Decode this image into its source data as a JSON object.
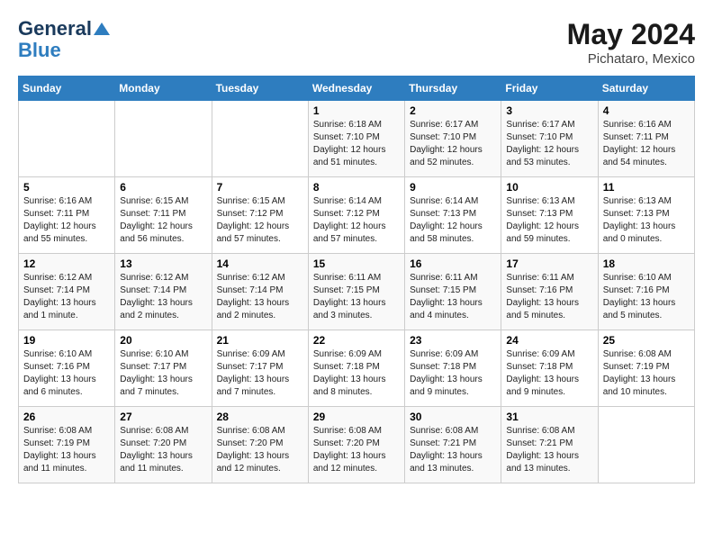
{
  "header": {
    "logo_line1": "General",
    "logo_line2": "Blue",
    "month_year": "May 2024",
    "location": "Pichataro, Mexico"
  },
  "days_of_week": [
    "Sunday",
    "Monday",
    "Tuesday",
    "Wednesday",
    "Thursday",
    "Friday",
    "Saturday"
  ],
  "weeks": [
    [
      {
        "day": "",
        "info": ""
      },
      {
        "day": "",
        "info": ""
      },
      {
        "day": "",
        "info": ""
      },
      {
        "day": "1",
        "info": "Sunrise: 6:18 AM\nSunset: 7:10 PM\nDaylight: 12 hours\nand 51 minutes."
      },
      {
        "day": "2",
        "info": "Sunrise: 6:17 AM\nSunset: 7:10 PM\nDaylight: 12 hours\nand 52 minutes."
      },
      {
        "day": "3",
        "info": "Sunrise: 6:17 AM\nSunset: 7:10 PM\nDaylight: 12 hours\nand 53 minutes."
      },
      {
        "day": "4",
        "info": "Sunrise: 6:16 AM\nSunset: 7:11 PM\nDaylight: 12 hours\nand 54 minutes."
      }
    ],
    [
      {
        "day": "5",
        "info": "Sunrise: 6:16 AM\nSunset: 7:11 PM\nDaylight: 12 hours\nand 55 minutes."
      },
      {
        "day": "6",
        "info": "Sunrise: 6:15 AM\nSunset: 7:11 PM\nDaylight: 12 hours\nand 56 minutes."
      },
      {
        "day": "7",
        "info": "Sunrise: 6:15 AM\nSunset: 7:12 PM\nDaylight: 12 hours\nand 57 minutes."
      },
      {
        "day": "8",
        "info": "Sunrise: 6:14 AM\nSunset: 7:12 PM\nDaylight: 12 hours\nand 57 minutes."
      },
      {
        "day": "9",
        "info": "Sunrise: 6:14 AM\nSunset: 7:13 PM\nDaylight: 12 hours\nand 58 minutes."
      },
      {
        "day": "10",
        "info": "Sunrise: 6:13 AM\nSunset: 7:13 PM\nDaylight: 12 hours\nand 59 minutes."
      },
      {
        "day": "11",
        "info": "Sunrise: 6:13 AM\nSunset: 7:13 PM\nDaylight: 13 hours\nand 0 minutes."
      }
    ],
    [
      {
        "day": "12",
        "info": "Sunrise: 6:12 AM\nSunset: 7:14 PM\nDaylight: 13 hours\nand 1 minute."
      },
      {
        "day": "13",
        "info": "Sunrise: 6:12 AM\nSunset: 7:14 PM\nDaylight: 13 hours\nand 2 minutes."
      },
      {
        "day": "14",
        "info": "Sunrise: 6:12 AM\nSunset: 7:14 PM\nDaylight: 13 hours\nand 2 minutes."
      },
      {
        "day": "15",
        "info": "Sunrise: 6:11 AM\nSunset: 7:15 PM\nDaylight: 13 hours\nand 3 minutes."
      },
      {
        "day": "16",
        "info": "Sunrise: 6:11 AM\nSunset: 7:15 PM\nDaylight: 13 hours\nand 4 minutes."
      },
      {
        "day": "17",
        "info": "Sunrise: 6:11 AM\nSunset: 7:16 PM\nDaylight: 13 hours\nand 5 minutes."
      },
      {
        "day": "18",
        "info": "Sunrise: 6:10 AM\nSunset: 7:16 PM\nDaylight: 13 hours\nand 5 minutes."
      }
    ],
    [
      {
        "day": "19",
        "info": "Sunrise: 6:10 AM\nSunset: 7:16 PM\nDaylight: 13 hours\nand 6 minutes."
      },
      {
        "day": "20",
        "info": "Sunrise: 6:10 AM\nSunset: 7:17 PM\nDaylight: 13 hours\nand 7 minutes."
      },
      {
        "day": "21",
        "info": "Sunrise: 6:09 AM\nSunset: 7:17 PM\nDaylight: 13 hours\nand 7 minutes."
      },
      {
        "day": "22",
        "info": "Sunrise: 6:09 AM\nSunset: 7:18 PM\nDaylight: 13 hours\nand 8 minutes."
      },
      {
        "day": "23",
        "info": "Sunrise: 6:09 AM\nSunset: 7:18 PM\nDaylight: 13 hours\nand 9 minutes."
      },
      {
        "day": "24",
        "info": "Sunrise: 6:09 AM\nSunset: 7:18 PM\nDaylight: 13 hours\nand 9 minutes."
      },
      {
        "day": "25",
        "info": "Sunrise: 6:08 AM\nSunset: 7:19 PM\nDaylight: 13 hours\nand 10 minutes."
      }
    ],
    [
      {
        "day": "26",
        "info": "Sunrise: 6:08 AM\nSunset: 7:19 PM\nDaylight: 13 hours\nand 11 minutes."
      },
      {
        "day": "27",
        "info": "Sunrise: 6:08 AM\nSunset: 7:20 PM\nDaylight: 13 hours\nand 11 minutes."
      },
      {
        "day": "28",
        "info": "Sunrise: 6:08 AM\nSunset: 7:20 PM\nDaylight: 13 hours\nand 12 minutes."
      },
      {
        "day": "29",
        "info": "Sunrise: 6:08 AM\nSunset: 7:20 PM\nDaylight: 13 hours\nand 12 minutes."
      },
      {
        "day": "30",
        "info": "Sunrise: 6:08 AM\nSunset: 7:21 PM\nDaylight: 13 hours\nand 13 minutes."
      },
      {
        "day": "31",
        "info": "Sunrise: 6:08 AM\nSunset: 7:21 PM\nDaylight: 13 hours\nand 13 minutes."
      },
      {
        "day": "",
        "info": ""
      }
    ]
  ]
}
